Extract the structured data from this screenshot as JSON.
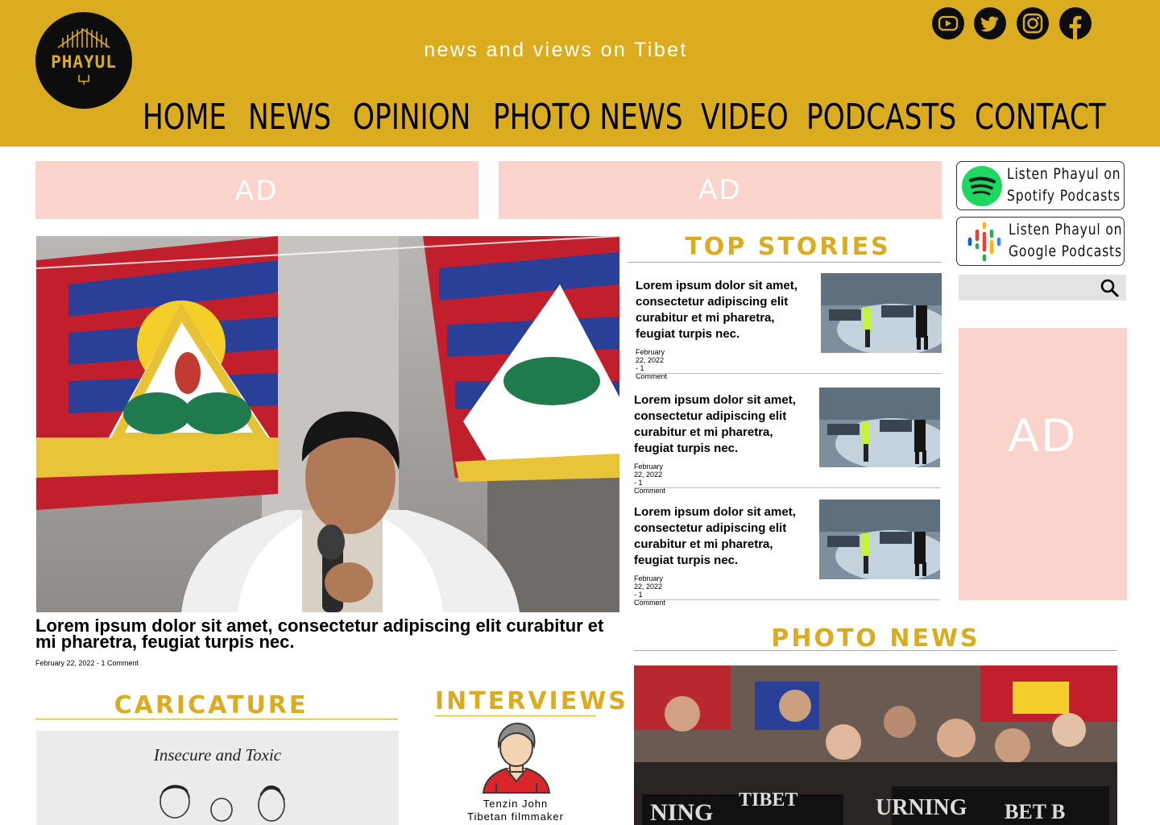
{
  "site": {
    "logo_text": "PHAYUL",
    "tagline": "news and views on Tibet"
  },
  "social": [
    {
      "icon": "youtube-icon"
    },
    {
      "icon": "twitter-icon"
    },
    {
      "icon": "instagram-icon"
    },
    {
      "icon": "facebook-icon"
    }
  ],
  "nav": {
    "items": [
      "HOME",
      "NEWS",
      "OPINION",
      "PHOTO NEWS",
      "VIDEO",
      "PODCASTS",
      "CONTACT"
    ]
  },
  "ads": {
    "top_left": "AD",
    "top_right": "AD",
    "sidebar": "AD"
  },
  "podcasts": {
    "spotify_line1": "Listen Phayul on",
    "spotify_line2": "Spotify Podcasts",
    "google_line1": "Listen Phayul on",
    "google_line2": "Google Podcasts"
  },
  "search": {
    "placeholder": ""
  },
  "hero": {
    "title": "Lorem ipsum dolor sit amet, consectetur adipiscing elit curabitur et mi pharetra, feugiat turpis nec.",
    "meta": "February 22, 2022 - 1 Comment"
  },
  "top_stories": {
    "heading": "TOP STORIES",
    "items": [
      {
        "title": "Lorem ipsum dolor sit amet, consectetur adipiscing elit curabitur et mi pharetra, feugiat turpis nec.",
        "meta": "February 22, 2022 - 1 Comment"
      },
      {
        "title": "Lorem ipsum dolor sit amet, consectetur adipiscing elit curabitur et mi pharetra, feugiat turpis nec.",
        "meta": "February 22, 2022 - 1 Comment"
      },
      {
        "title": "Lorem ipsum dolor sit amet, consectetur adipiscing elit curabitur et mi pharetra, feugiat turpis nec.",
        "meta": "February 22, 2022 - 1 Comment"
      }
    ]
  },
  "photo_news": {
    "heading": "PHOTO NEWS"
  },
  "caricature": {
    "heading": "CARICATURE",
    "caption": "Insecure and Toxic"
  },
  "interviews": {
    "heading": "INTERVIEWS",
    "name": "Tenzin John",
    "role": "Tibetan filmmaker"
  },
  "colors": {
    "brand_gold": "#dbac1f",
    "ad_pink": "#f9d3cc",
    "black": "#0d0d0d"
  }
}
